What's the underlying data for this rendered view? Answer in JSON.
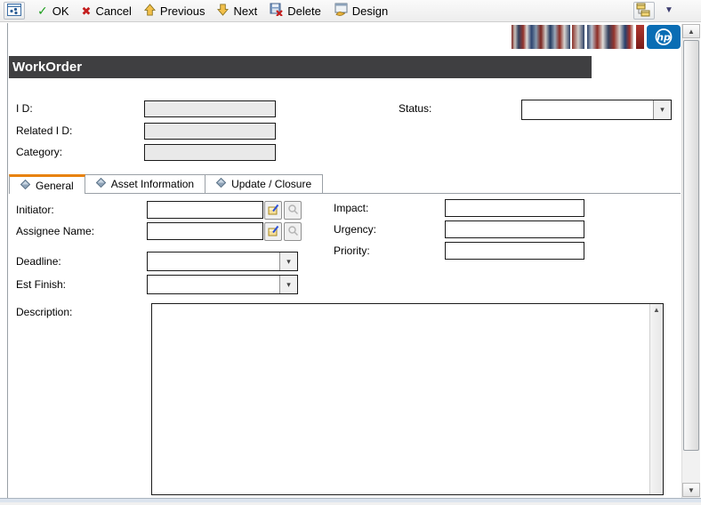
{
  "toolbar": {
    "buttons": [
      {
        "label": "OK",
        "icon": "ok-check-icon"
      },
      {
        "label": "Cancel",
        "icon": "cancel-x-icon"
      },
      {
        "label": "Previous",
        "icon": "previous-arrow-up-icon"
      },
      {
        "label": "Next",
        "icon": "next-arrow-down-icon"
      },
      {
        "label": "Delete",
        "icon": "delete-record-icon"
      },
      {
        "label": "Design",
        "icon": "design-icon"
      }
    ],
    "right_icons": [
      "record-tree-icon",
      "more-dropdown-icon"
    ]
  },
  "branding": {
    "logo_text": "hp"
  },
  "form": {
    "title": "WorkOrder",
    "fields": {
      "id": {
        "label": "I D:",
        "value": ""
      },
      "related_id": {
        "label": "Related I D:",
        "value": ""
      },
      "category": {
        "label": "Category:",
        "value": ""
      },
      "status": {
        "label": "Status:",
        "value": ""
      }
    },
    "tabs": [
      {
        "label": "General",
        "active": true
      },
      {
        "label": "Asset Information",
        "active": false
      },
      {
        "label": "Update / Closure",
        "active": false
      }
    ],
    "general": {
      "initiator": {
        "label": "Initiator:",
        "value": ""
      },
      "assignee": {
        "label": "Assignee Name:",
        "value": ""
      },
      "deadline": {
        "label": "Deadline:",
        "value": ""
      },
      "est_finish": {
        "label": "Est Finish:",
        "value": ""
      },
      "impact": {
        "label": "Impact:",
        "value": ""
      },
      "urgency": {
        "label": "Urgency:",
        "value": ""
      },
      "priority": {
        "label": "Priority:",
        "value": ""
      },
      "description": {
        "label": "Description:",
        "value": ""
      }
    }
  },
  "colors": {
    "accent_orange": "#e8820c",
    "header_bg": "#3f3f41",
    "hp_blue": "#0a6db4",
    "readonly_field_bg": "#e9e9e9"
  }
}
